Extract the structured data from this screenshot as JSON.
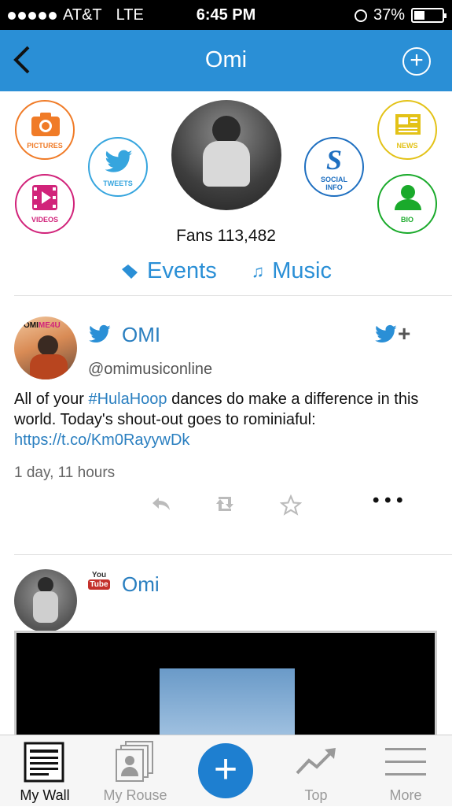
{
  "status": {
    "carrier": "AT&T",
    "network": "LTE",
    "time": "6:45 PM",
    "battery": "37%",
    "battery_level": 0.37
  },
  "nav": {
    "title": "Omi"
  },
  "profile": {
    "circles": {
      "pictures": "PICTURES",
      "tweets": "TWEETS",
      "videos": "VIDEOS",
      "social_info_top": "SOCIAL",
      "social_info_bottom": "INFO",
      "news": "NEWS",
      "bio": "BIO"
    },
    "fans": "Fans 113,482",
    "events_label": "Events",
    "music_label": "Music"
  },
  "colors": {
    "accent": "#2a8fd6",
    "pictures": "#f07b27",
    "tweets": "#36a5de",
    "videos": "#d1237a",
    "social": "#1e6fc0",
    "news": "#e3c217",
    "bio": "#1aaa2b"
  },
  "post1": {
    "avatar_text_a": "OMI",
    "avatar_text_b": "ME4U",
    "name": "OMI",
    "handle": "@omimusiconline",
    "text_before": "All of your ",
    "hashtag": "#HulaHoop",
    "text_after": " dances do make a difference in this world. Today's shout-out goes to rominiaful: ",
    "link": "https://t.co/Km0RayywDk",
    "time_ago": "1 day, 11 hours",
    "more": "• • •"
  },
  "post2": {
    "name": "Omi",
    "youtube_top": "You",
    "youtube_bottom": "Tube"
  },
  "tabs": {
    "my_wall": "My Wall",
    "my_rouse": "My Rouse",
    "top": "Top",
    "more": "More"
  }
}
